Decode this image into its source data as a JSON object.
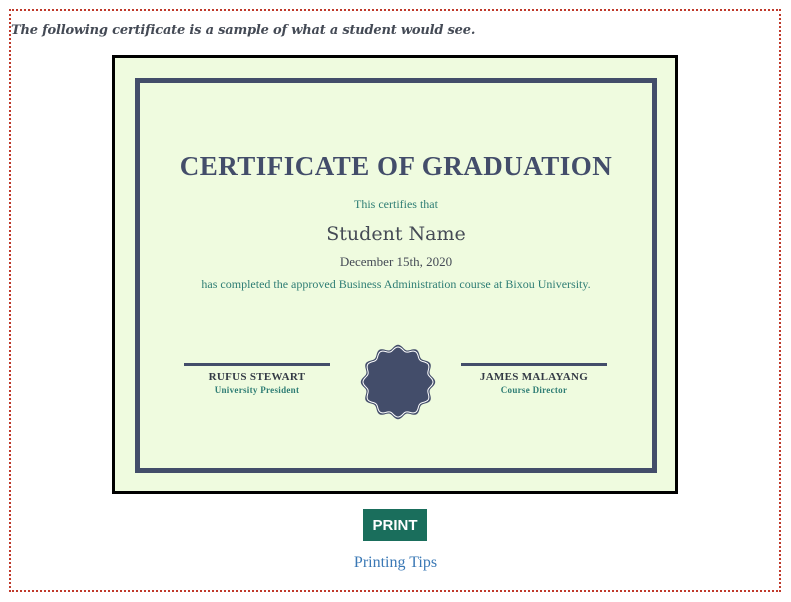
{
  "intro_text": "The following certificate is a sample of what a student would see.",
  "certificate": {
    "title": "CERTIFICATE OF GRADUATION",
    "certifies": "This certifies that",
    "student_name": "Student Name",
    "date": "December 15th, 2020",
    "completion": "has completed the approved Business Administration course at Bixou University.",
    "signatories": [
      {
        "name": "RUFUS STEWART",
        "role": "University President"
      },
      {
        "name": "JAMES MALAYANG",
        "role": "Course Director"
      }
    ],
    "seal_icon": "seal-icon"
  },
  "actions": {
    "print_label": "PRINT",
    "tips_label": "Printing Tips"
  },
  "colors": {
    "certificate_background": "#effbdf",
    "certificate_border": "#434d6a",
    "accent_teal": "#2e7d74",
    "print_button": "#1a6e5c",
    "link": "#3a78b5",
    "frame_dotted": "#c0392b"
  }
}
